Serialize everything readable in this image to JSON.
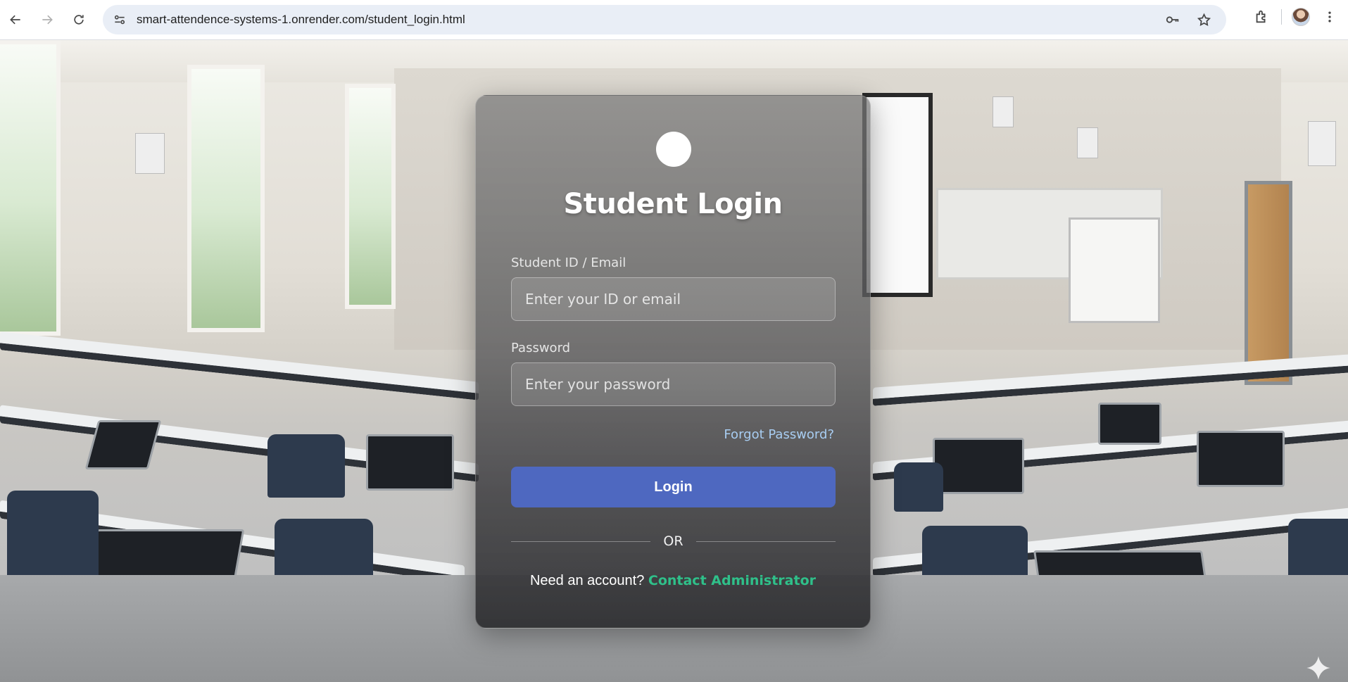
{
  "browser": {
    "url": "smart-attendence-systems-1.onrender.com/student_login.html",
    "icons": [
      "back-arrow-icon",
      "forward-arrow-icon",
      "reload-icon",
      "site-info-icon",
      "key-icon",
      "star-icon",
      "extensions-icon",
      "avatar",
      "kebab-menu-icon"
    ]
  },
  "login": {
    "title": "Student Login",
    "id_label": "Student ID / Email",
    "id_placeholder": "Enter your ID or email",
    "password_label": "Password",
    "password_placeholder": "Enter your password",
    "forgot_link": "Forgot Password?",
    "login_button": "Login",
    "divider_text": "OR",
    "account_prompt": "Need an account?",
    "contact_link": "Contact Administrator"
  },
  "colors": {
    "button": "#4e68c0",
    "forgot_link": "#a8cdf2",
    "contact_link": "#2fc08a"
  }
}
